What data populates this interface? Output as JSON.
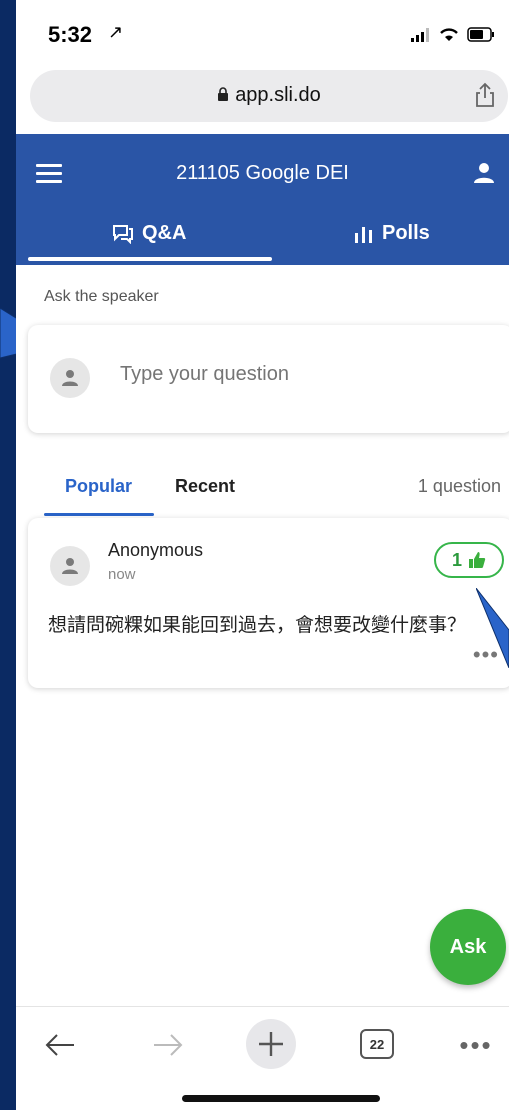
{
  "status_bar": {
    "time": "5:32",
    "location_glyph": "↗"
  },
  "browser": {
    "url": "app.sli.do",
    "tabs_count": "22"
  },
  "header": {
    "title": "211105 Google DEI",
    "tabs": [
      {
        "label": "Q&A"
      },
      {
        "label": "Polls"
      }
    ]
  },
  "ask": {
    "label": "Ask the speaker",
    "placeholder": "Type your question",
    "fab_label": "Ask"
  },
  "list": {
    "tabs": [
      {
        "label": "Popular"
      },
      {
        "label": "Recent"
      }
    ],
    "count_label": "1 question"
  },
  "questions": [
    {
      "author": "Anonymous",
      "time": "now",
      "likes": "1",
      "text": "想請問碗粿如果能回到過去，會想要改變什麼事？"
    }
  ],
  "colors": {
    "brand_blue": "#2a55a6",
    "accent_blue": "#2a64c9",
    "green": "#3aaf3d",
    "background_navy": "#0b2a63"
  }
}
